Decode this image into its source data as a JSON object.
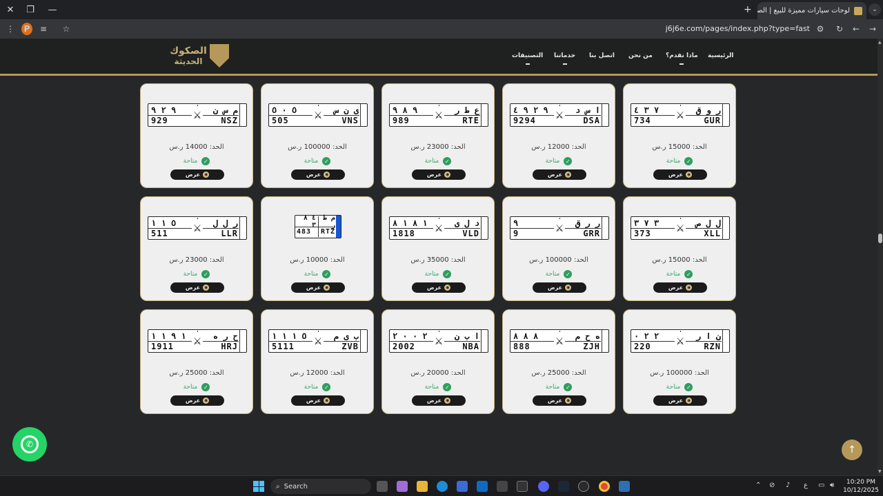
{
  "browser": {
    "tab_title": "لوحات سيارات مميزة للبيع | الصك",
    "url": "j6j6e.com/pages/index.php?type=fast",
    "profile_initial": "P"
  },
  "site": {
    "logo_line1": "الصكوك",
    "logo_line2": "الحديثة",
    "nav": [
      "الرئيسية",
      "ماذا نقدم؟",
      "من نحن",
      "اتصل بنا",
      "خدماتنا",
      "التصنيفات"
    ]
  },
  "labels": {
    "price_prefix": "الحد:",
    "currency": "ر.س",
    "available": "متاحة",
    "view": "عرض"
  },
  "plates": [
    {
      "ar_letters": "ر و ق",
      "ar_digits": "٧ ٣ ٤",
      "en_digits": "734",
      "en_letters": "GUR",
      "price": "15000"
    },
    {
      "ar_letters": "ا س د",
      "ar_digits": "٩ ٢ ٩ ٤",
      "en_digits": "9294",
      "en_letters": "DSA",
      "price": "12000"
    },
    {
      "ar_letters": "ع ط ر",
      "ar_digits": "٩ ٨ ٩",
      "en_digits": "989",
      "en_letters": "RTE",
      "price": "23000"
    },
    {
      "ar_letters": "ى ن س",
      "ar_digits": "٥ ٠ ٥",
      "en_digits": "505",
      "en_letters": "VNS",
      "price": "100000"
    },
    {
      "ar_letters": "م س ن",
      "ar_digits": "٩ ٢ ٩",
      "en_digits": "929",
      "en_letters": "NSZ",
      "price": "14000"
    },
    {
      "ar_letters": "ل ل ص",
      "ar_digits": "٣ ٧ ٣",
      "en_digits": "373",
      "en_letters": "XLL",
      "price": "15000"
    },
    {
      "ar_letters": "ر ر ق",
      "ar_digits": "٩",
      "en_digits": "9",
      "en_letters": "GRR",
      "price": "100000"
    },
    {
      "ar_letters": "د ل ى",
      "ar_digits": "١ ٨ ١ ٨",
      "en_digits": "1818",
      "en_letters": "VLD",
      "price": "35000"
    },
    {
      "ar_letters": "م ط ر",
      "ar_digits": "٤ ٨ ٣",
      "en_digits": "483",
      "en_letters": "RTZ",
      "price": "10000"
    },
    {
      "ar_letters": "ر ل ل",
      "ar_digits": "٥ ١ ١",
      "en_digits": "511",
      "en_letters": "LLR",
      "price": "23000"
    },
    {
      "ar_letters": "ن ا ر",
      "ar_digits": "٢ ٢ ٠",
      "en_digits": "220",
      "en_letters": "RZN",
      "price": "100000"
    },
    {
      "ar_letters": "ه ح م",
      "ar_digits": "٨ ٨ ٨",
      "en_digits": "888",
      "en_letters": "ZJH",
      "price": "25000"
    },
    {
      "ar_letters": "ا ب ن",
      "ar_digits": "٢ ٠ ٠ ٢",
      "en_digits": "2002",
      "en_letters": "NBA",
      "price": "20000"
    },
    {
      "ar_letters": "ب ى م",
      "ar_digits": "٥ ١ ١ ١",
      "en_digits": "5111",
      "en_letters": "ZVB",
      "price": "12000"
    },
    {
      "ar_letters": "ح ر ه",
      "ar_digits": "١ ٩ ١ ١",
      "en_digits": "1911",
      "en_letters": "HRJ",
      "price": "25000"
    }
  ],
  "taskbar": {
    "search_placeholder": "Search",
    "lang": "ع",
    "time": "10:20 PM",
    "date": "10/12/2025"
  }
}
